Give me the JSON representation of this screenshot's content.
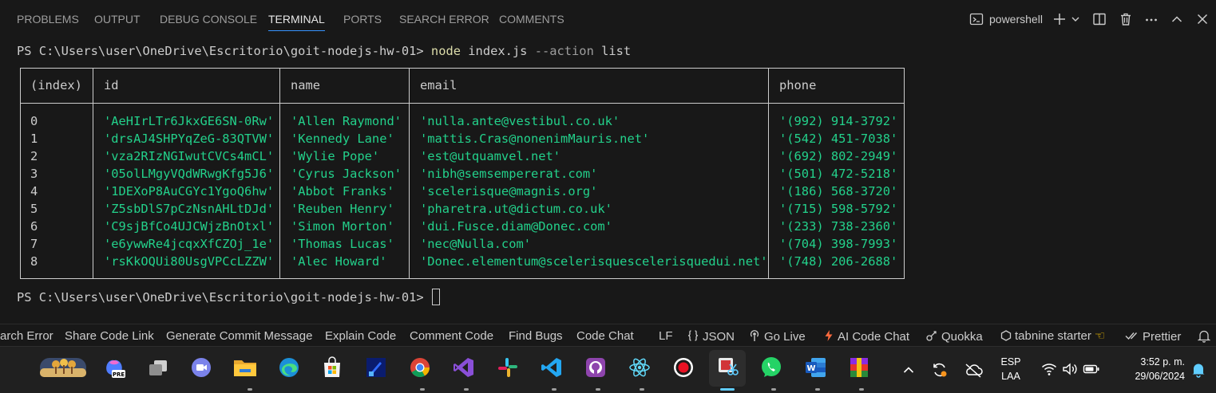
{
  "panel": {
    "tabs": [
      {
        "label": "PROBLEMS",
        "active": false
      },
      {
        "label": "OUTPUT",
        "active": false
      },
      {
        "label": "DEBUG CONSOLE",
        "active": false
      },
      {
        "label": "TERMINAL",
        "active": true
      },
      {
        "label": "PORTS",
        "active": false
      },
      {
        "label": "SEARCH ERROR",
        "active": false
      },
      {
        "label": "COMMENTS",
        "active": false
      }
    ],
    "shell_name": "powershell",
    "actions": [
      "terminal-icon",
      "add-icon",
      "chevron-down-icon",
      "split-icon",
      "trash-icon",
      "ellipsis-icon",
      "chevron-up-icon",
      "close-icon"
    ]
  },
  "terminal": {
    "prompt": "PS C:\\Users\\user\\OneDrive\\Escritorio\\goit-nodejs-hw-01>",
    "command": {
      "program": "node",
      "args": "index.js",
      "flags": "--action",
      "value": "list"
    },
    "table": {
      "headers": [
        "(index)",
        "id",
        "name",
        "email",
        "phone"
      ],
      "rows": [
        [
          "0",
          "'AeHIrLTr6JkxGE6SN-0Rw'",
          "'Allen Raymond'",
          "'nulla.ante@vestibul.co.uk'",
          "'(992) 914-3792'"
        ],
        [
          "1",
          "'drsAJ4SHPYqZeG-83QTVW'",
          "'Kennedy Lane'",
          "'mattis.Cras@nonenimMauris.net'",
          "'(542) 451-7038'"
        ],
        [
          "2",
          "'vza2RIzNGIwutCVCs4mCL'",
          "'Wylie Pope'",
          "'est@utquamvel.net'",
          "'(692) 802-2949'"
        ],
        [
          "3",
          "'05olLMgyVQdWRwgKfg5J6'",
          "'Cyrus Jackson'",
          "'nibh@semsempererat.com'",
          "'(501) 472-5218'"
        ],
        [
          "4",
          "'1DEXoP8AuCGYc1YgoQ6hw'",
          "'Abbot Franks'",
          "'scelerisque@magnis.org'",
          "'(186) 568-3720'"
        ],
        [
          "5",
          "'Z5sbDlS7pCzNsnAHLtDJd'",
          "'Reuben Henry'",
          "'pharetra.ut@dictum.co.uk'",
          "'(715) 598-5792'"
        ],
        [
          "6",
          "'C9sjBfCo4UJCWjzBnOtxl'",
          "'Simon Morton'",
          "'dui.Fusce.diam@Donec.com'",
          "'(233) 738-2360'"
        ],
        [
          "7",
          "'e6ywwRe4jcqxXfCZOj_1e'",
          "'Thomas Lucas'",
          "'nec@Nulla.com'",
          "'(704) 398-7993'"
        ],
        [
          "8",
          "'rsKkOQUi80UsgVPCcLZZW'",
          "'Alec Howard'",
          "'Donec.elementum@scelerisquescelerisquedui.net'",
          "'(748) 206-2688'"
        ]
      ]
    },
    "prompt2": "PS C:\\Users\\user\\OneDrive\\Escritorio\\goit-nodejs-hw-01>"
  },
  "statusbar": {
    "items": [
      {
        "label": "arch Error",
        "icon": ""
      },
      {
        "label": "Share Code Link",
        "icon": ""
      },
      {
        "label": "Generate Commit Message",
        "icon": ""
      },
      {
        "label": "Explain Code",
        "icon": ""
      },
      {
        "label": "Comment Code",
        "icon": ""
      },
      {
        "label": "Find Bugs",
        "icon": ""
      },
      {
        "label": "Code Chat",
        "icon": ""
      },
      {
        "label": "LF",
        "icon": ""
      },
      {
        "label": "JSON",
        "icon": "braces-icon"
      },
      {
        "label": "Go Live",
        "icon": "broadcast-icon"
      },
      {
        "label": "AI Code Chat",
        "icon": "bolt-icon"
      },
      {
        "label": "Quokka",
        "icon": "quokka-icon"
      },
      {
        "label": "tabnine starter",
        "icon": "tabnine-icon"
      },
      {
        "label": "Prettier",
        "icon": "double-check-icon"
      }
    ],
    "bell_icon": "bell-icon"
  },
  "taskbar": {
    "apps": [
      {
        "name": "widgets-weather-icon"
      },
      {
        "name": "copilot-pre-icon"
      },
      {
        "name": "task-view-icon"
      },
      {
        "name": "chat-video-icon"
      },
      {
        "name": "file-explorer-icon"
      },
      {
        "name": "edge-icon"
      },
      {
        "name": "microsoft-store-icon"
      },
      {
        "name": "app-square-icon"
      },
      {
        "name": "chrome-icon"
      },
      {
        "name": "visual-studio-icon"
      },
      {
        "name": "slack-icon"
      },
      {
        "name": "vscode-icon"
      },
      {
        "name": "github-desktop-icon"
      },
      {
        "name": "react-devtools-icon"
      },
      {
        "name": "record-icon"
      },
      {
        "name": "snipping-tool-icon"
      },
      {
        "name": "whatsapp-icon"
      },
      {
        "name": "word-icon"
      },
      {
        "name": "winrar-icon"
      }
    ],
    "tray": {
      "language_line1": "ESP",
      "language_line2": "LAA",
      "time": "3:52 p. m.",
      "date": "29/06/2024"
    }
  },
  "colors": {
    "background": "#181818",
    "table_value_green": "#23d18b",
    "command_yellow": "#dcdcaa",
    "active_tab_underline": "#3794ff"
  }
}
